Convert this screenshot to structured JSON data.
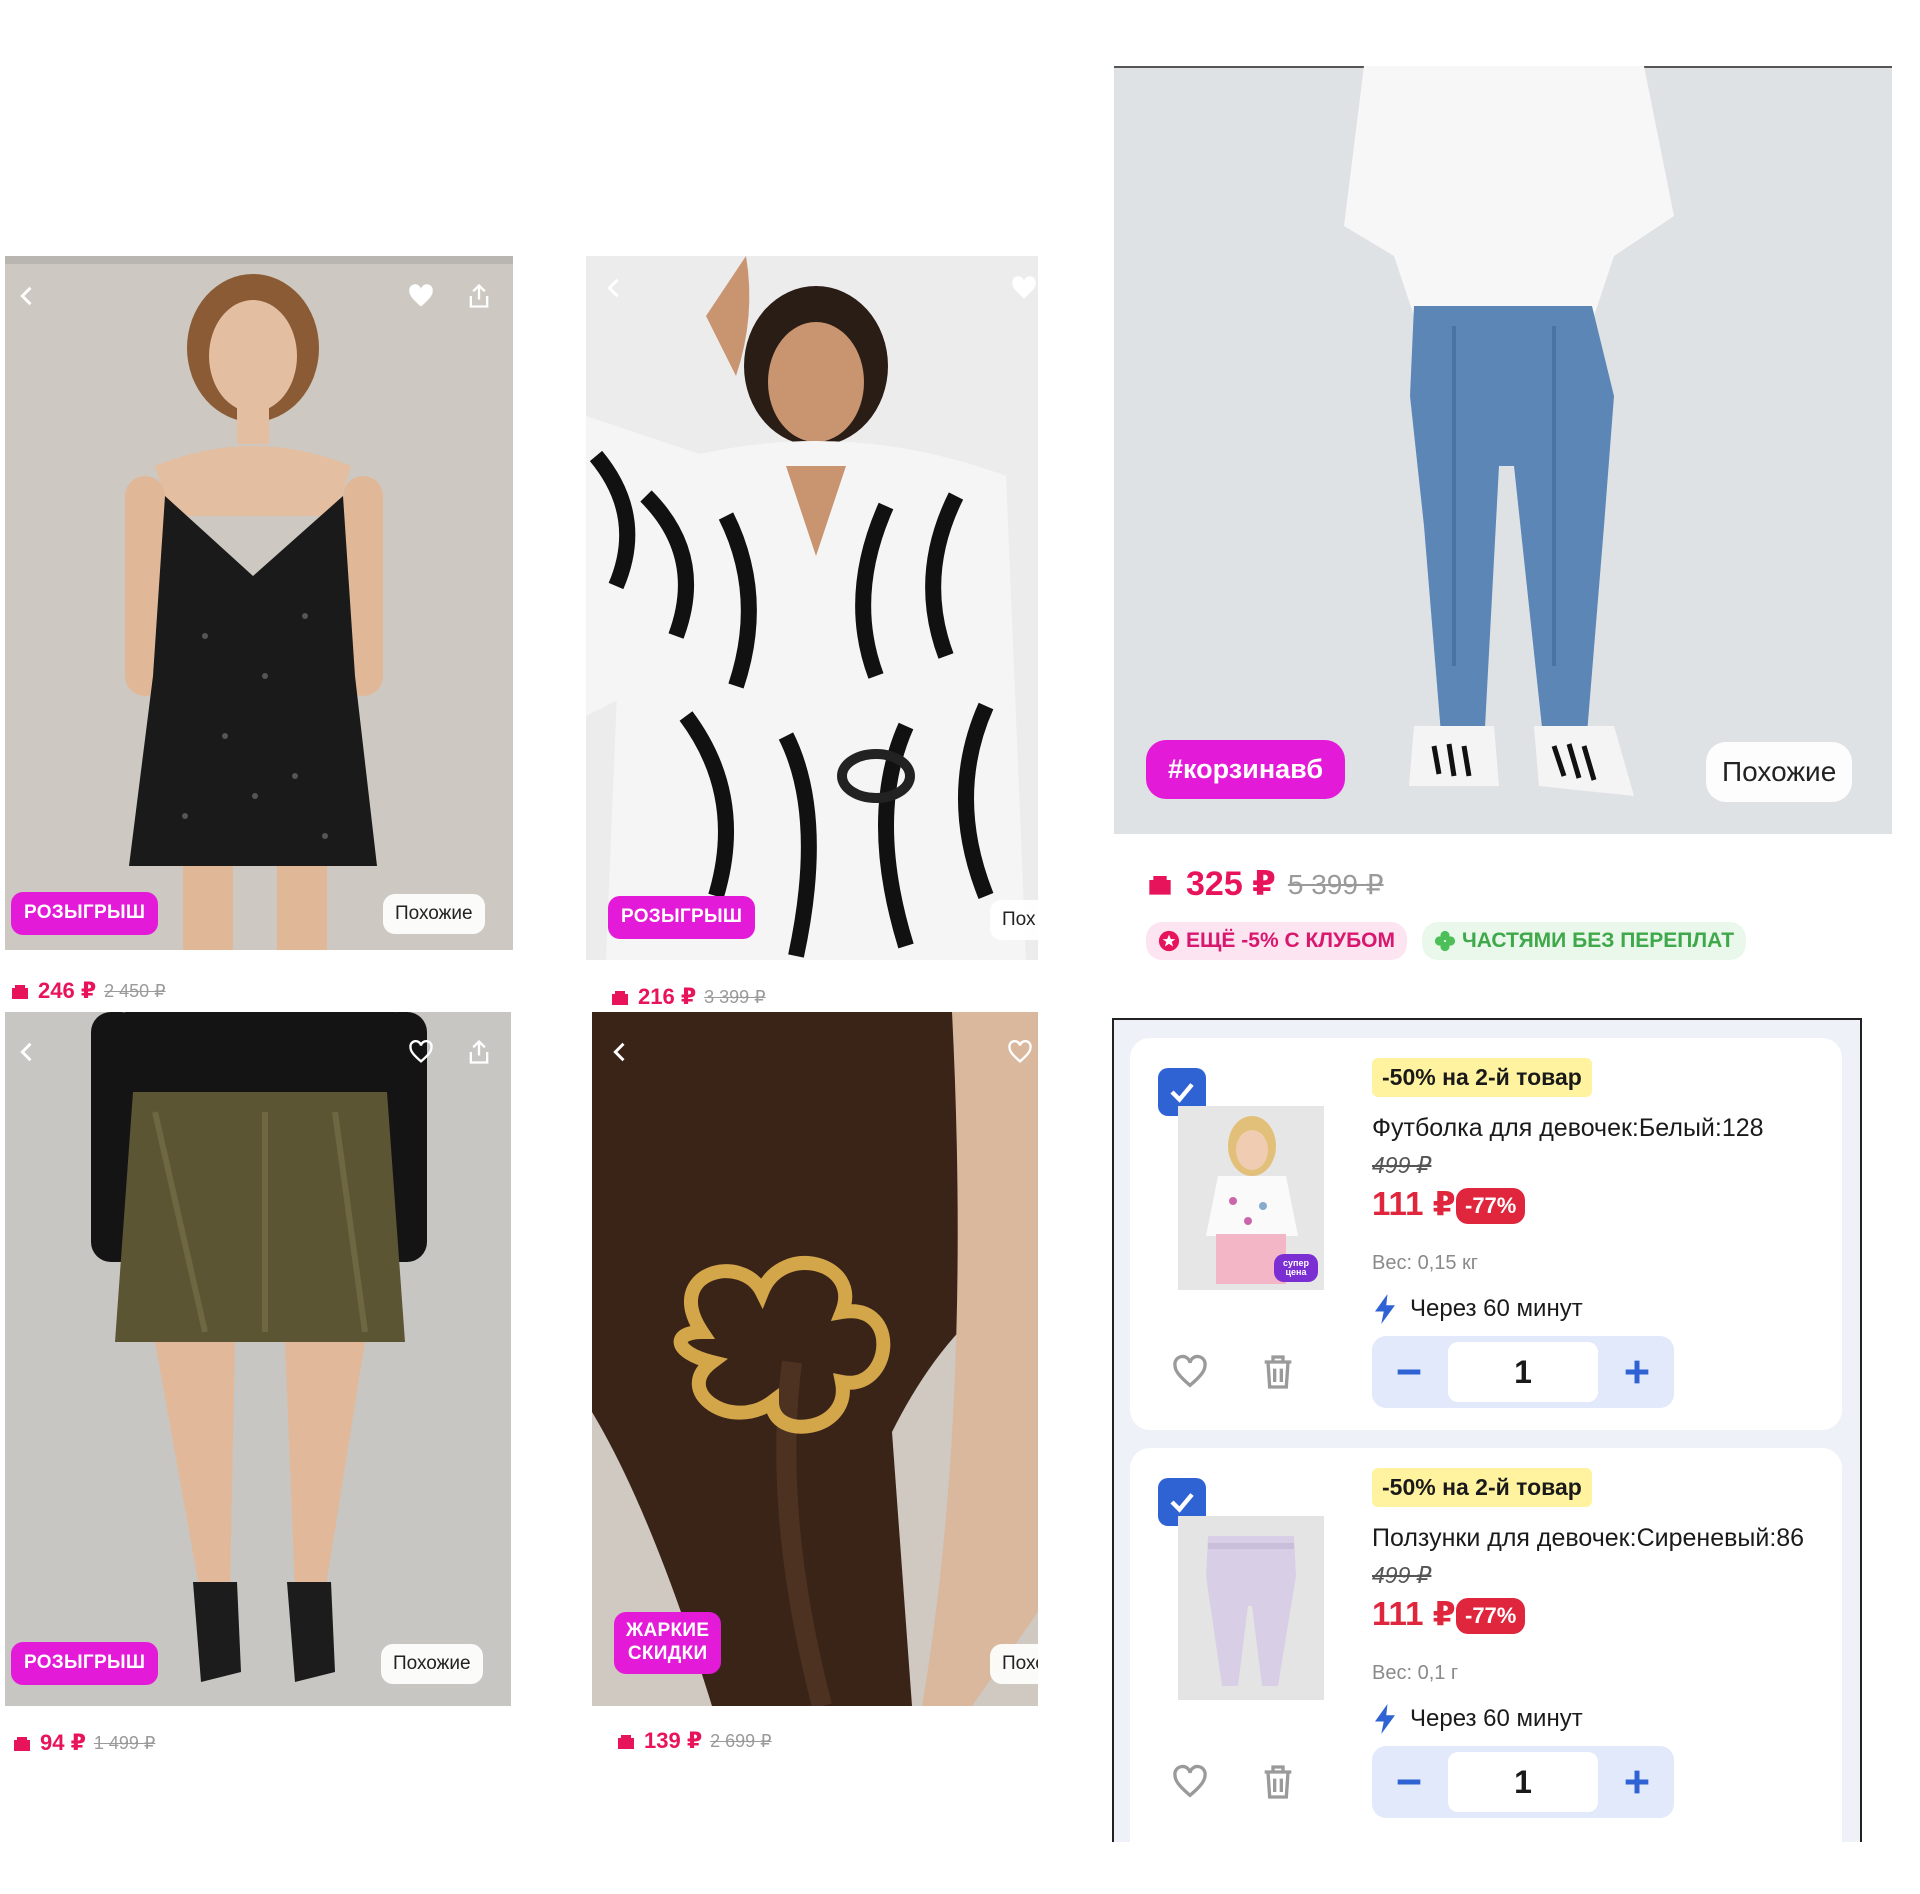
{
  "tiles": {
    "dress": {
      "badge": "РОЗЫГРЫШ",
      "similar": "Похожие",
      "price": "246 ₽",
      "old_price": "2 450 ₽"
    },
    "zebra": {
      "badge": "РОЗЫГРЫШ",
      "similar": "Пох",
      "price": "216 ₽",
      "old_price": "3 399 ₽"
    },
    "skirt": {
      "badge": "РОЗЫГРЫШ",
      "similar": "Похожие",
      "price": "94 ₽",
      "old_price": "1 499 ₽"
    },
    "clip": {
      "badge_line1": "ЖАРКИЕ",
      "badge_line2": "СКИДКИ",
      "similar": "Похо",
      "price": "139 ₽",
      "old_price": "2 699 ₽"
    }
  },
  "jeans": {
    "hashtag": "#корзинавб",
    "similar": "Похожие",
    "price": "325 ₽",
    "old_price": "5 399 ₽",
    "chip_club": "ЕЩЁ -5% С КЛУБОМ",
    "chip_parts": "ЧАСТЯМИ БЕЗ ПЕРЕПЛАТ"
  },
  "cart": {
    "items": [
      {
        "promo": "-50% на 2-й товар",
        "name": "Футболка для девочек:Белый:128",
        "old_price": "499 ₽",
        "price": "111 ₽",
        "discount": "-77%",
        "thumb_badge": "супер цена",
        "weight": "Вес: 0,15 кг",
        "delivery": "Через 60 минут",
        "qty": "1"
      },
      {
        "promo": "-50% на 2-й товар",
        "name": "Ползунки для девочек:Сиреневый:86",
        "old_price": "499 ₽",
        "price": "111 ₽",
        "discount": "-77%",
        "weight": "Вес: 0,1 г",
        "delivery": "Через 60 минут",
        "qty": "1"
      }
    ]
  },
  "colors": {
    "accent_magenta": "#e31bd8",
    "price_pink": "#e8145b",
    "cart_red": "#e0263d",
    "cart_blue": "#2f62d3"
  }
}
